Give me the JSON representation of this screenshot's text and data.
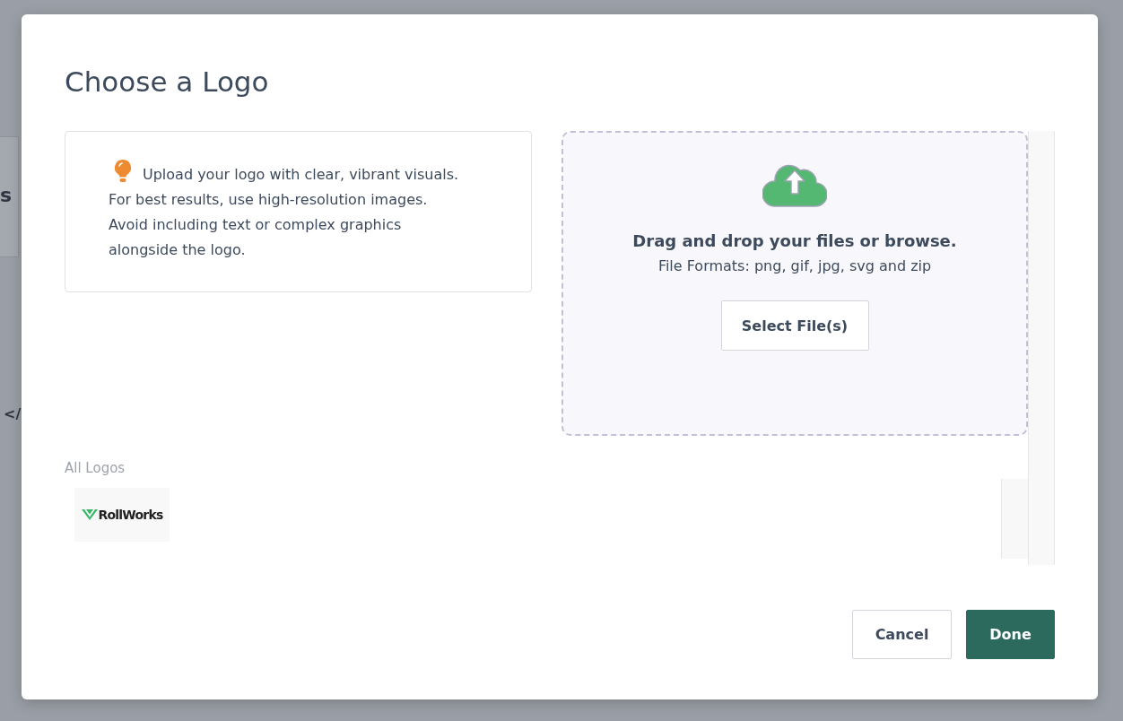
{
  "backdrop": {
    "fragments": [
      "s",
      "</"
    ]
  },
  "dialog": {
    "title": "Choose a Logo",
    "tip": "Upload your logo with clear, vibrant visuals. For best results, use high-resolution images. Avoid including text or complex graphics alongside the logo.",
    "dropzone": {
      "heading": "Drag and drop your files or browse.",
      "formats": "File Formats: png, gif, jpg, svg and zip",
      "button": "Select File(s)"
    },
    "logos_label": "All Logos",
    "logos": [
      {
        "name": "RollWorks"
      }
    ],
    "buttons": [
      {
        "label": "Cancel",
        "kind": "secondary"
      },
      {
        "label": "Done",
        "kind": "primary"
      }
    ]
  }
}
